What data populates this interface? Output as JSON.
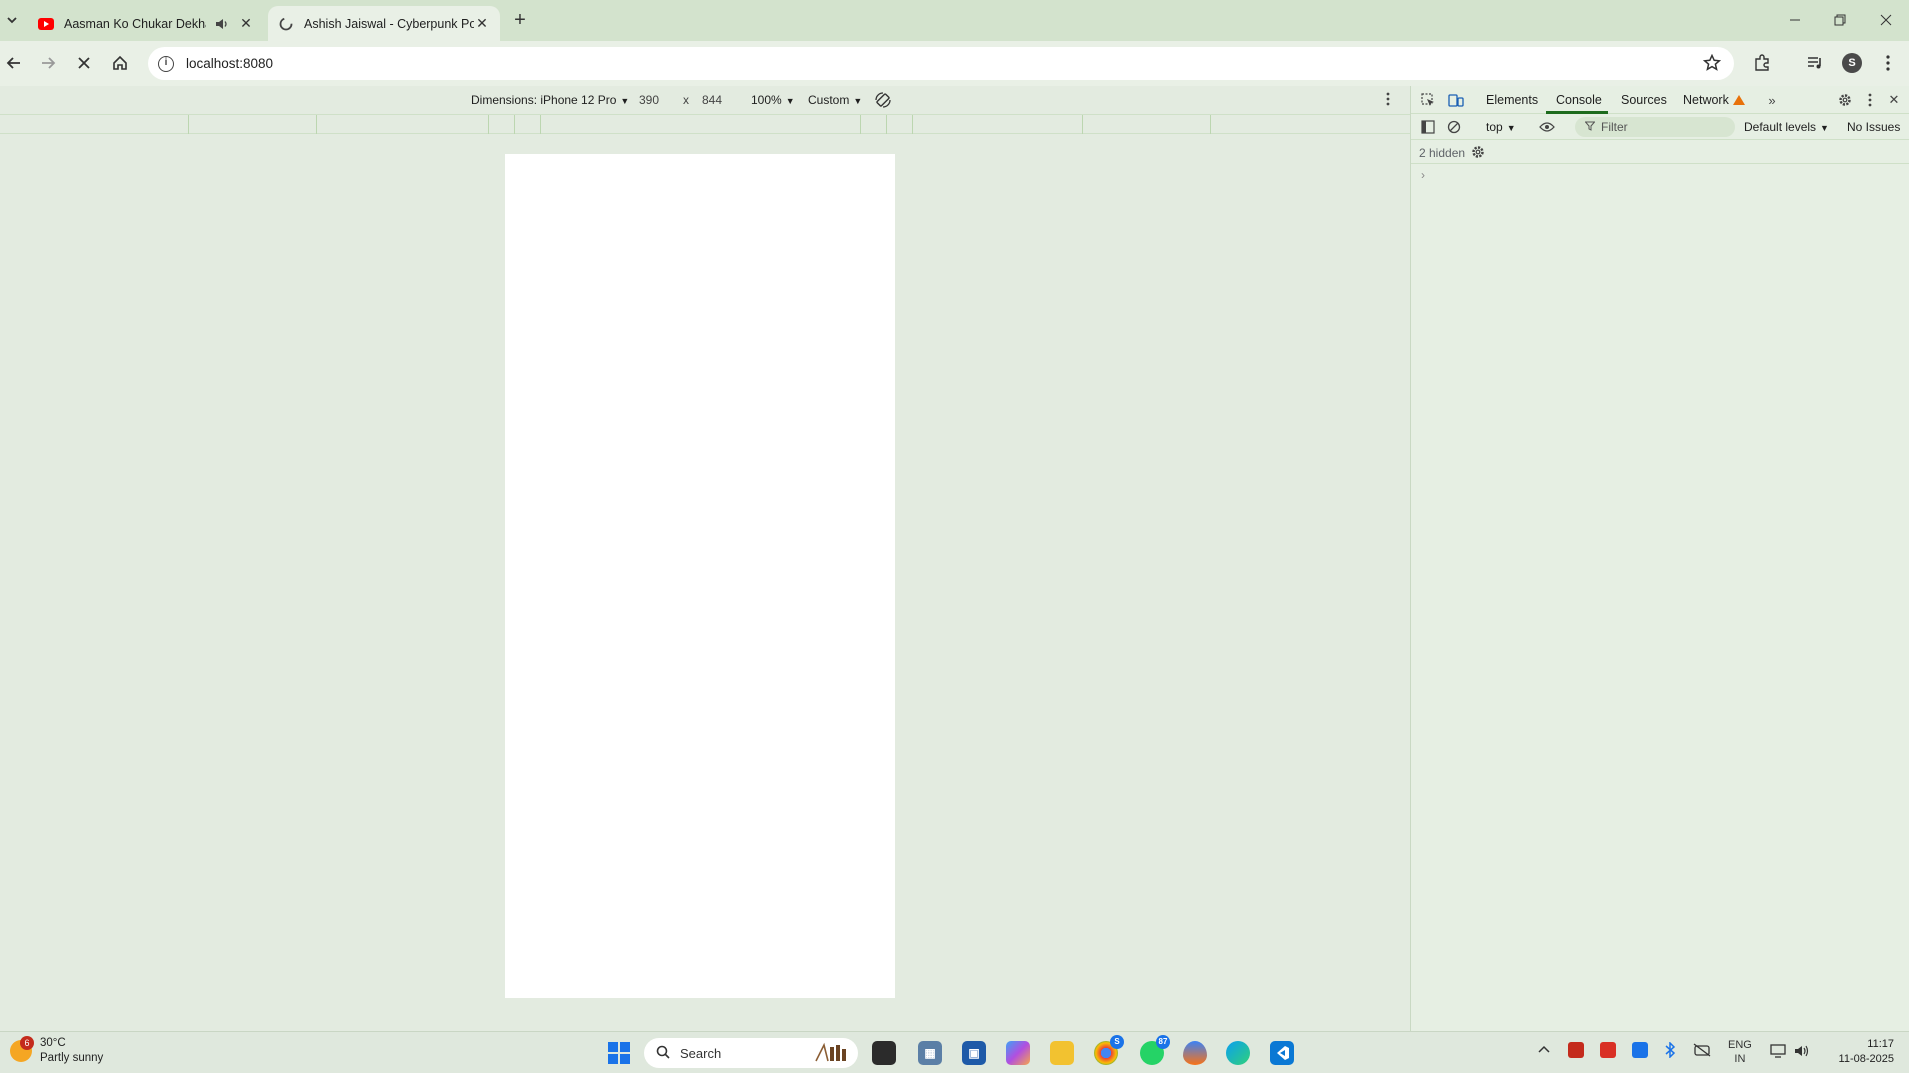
{
  "browser": {
    "tabs": [
      {
        "title": "Aasman Ko Chukar Dekha |",
        "icon": "youtube-icon",
        "audio": "speaker-icon",
        "active": false
      },
      {
        "title": "Ashish Jaiswal - Cyberpunk Port",
        "icon": "globe-loading-icon",
        "active": true
      }
    ],
    "new_tab": "+",
    "url": "localhost:8080"
  },
  "device_toolbar": {
    "dimensions_label": "Dimensions: iPhone 12 Pro",
    "width": "390",
    "times": "x",
    "height": "844",
    "zoom": "100%",
    "throttle": "Custom"
  },
  "devtools": {
    "tabs": [
      "Elements",
      "Console",
      "Sources",
      "Network"
    ],
    "active_tab": "Console",
    "context": "top",
    "filter_placeholder": "Filter",
    "levels": "Default levels",
    "issues": "No Issues",
    "hidden": "2 hidden",
    "prompt": "›"
  },
  "taskbar": {
    "weather_badge": "6",
    "temperature": "30°C",
    "condition": "Partly sunny",
    "search_label": "Search",
    "whatsapp_count": "87",
    "chrome_count": "S",
    "lang_1": "ENG",
    "lang_2": "IN",
    "time": "11:17",
    "date": "11-08-2025"
  }
}
